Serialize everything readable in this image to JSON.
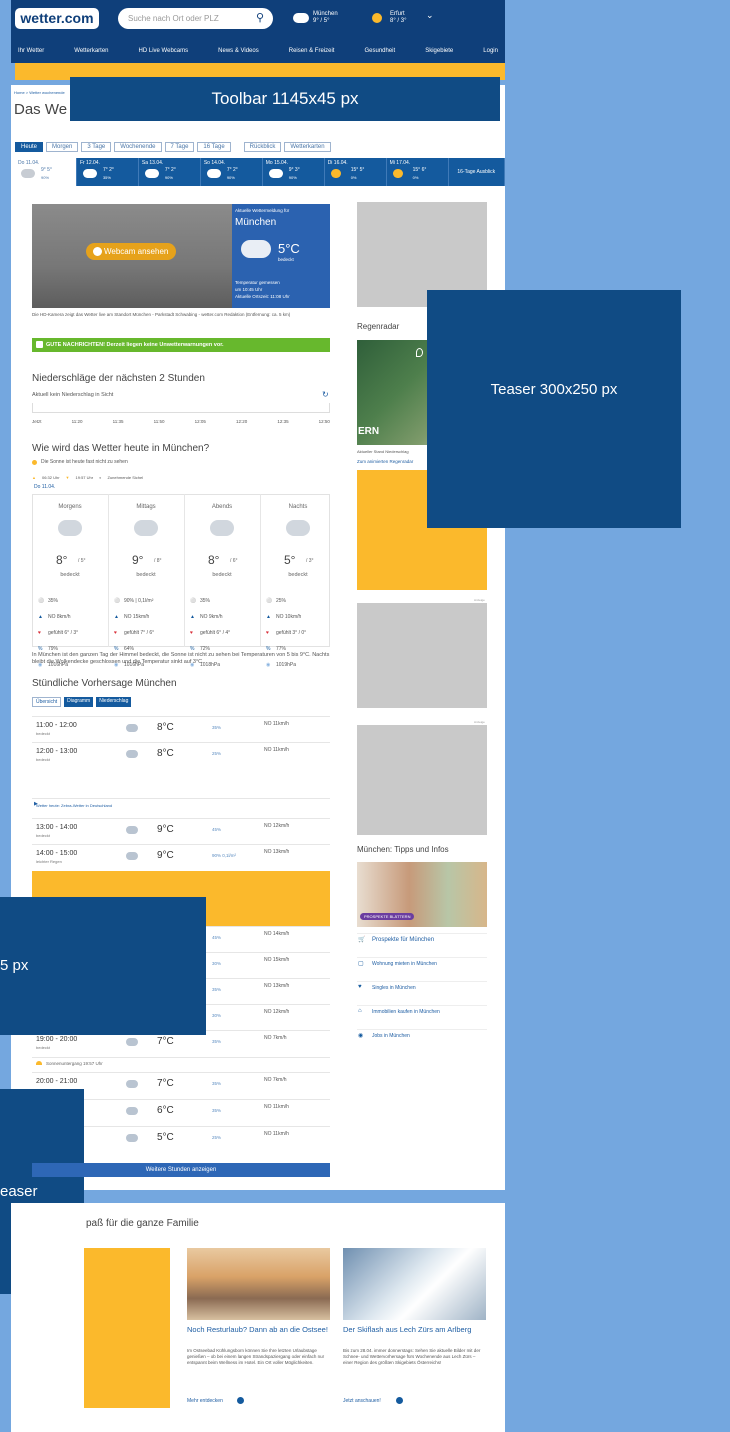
{
  "header": {
    "logo": "wetter.com",
    "search_placeholder": "Suche nach Ort oder PLZ",
    "loc1": "München",
    "loc1_temp": "9° / 5°",
    "loc2": "Erfurt",
    "loc2_temp": "8° / 3°",
    "nav": [
      "Ihr Wetter",
      "Wetterkarten",
      "HD Live Webcams",
      "News & Videos",
      "Reisen & Freizeit",
      "Gesundheit",
      "Skigebiete",
      "Login"
    ]
  },
  "breadcrumb": "Home > Wetter wochenende",
  "page_title": "Das We",
  "toolbar_label": "Toolbar 1145x45 px",
  "tabs": [
    "Heute",
    "Morgen",
    "3 Tage",
    "Wochenende",
    "7 Tage",
    "16 Tage",
    "Rückblick",
    "Wetterkarten"
  ],
  "days": [
    {
      "d": "Do 11.04.",
      "t": "9° 5°",
      "p": "90%"
    },
    {
      "d": "Fr 12.04.",
      "t": "7° 2°",
      "p": "35%"
    },
    {
      "d": "Sa 13.04.",
      "t": "7° 2°",
      "p": "90%"
    },
    {
      "d": "So 14.04.",
      "t": "7° 2°",
      "p": "90%"
    },
    {
      "d": "Mo 15.04.",
      "t": "9° 3°",
      "p": "90%"
    },
    {
      "d": "Di 16.04.",
      "t": "15° 5°",
      "p": "0%"
    },
    {
      "d": "Mi 17.04.",
      "t": "15° 6°",
      "p": "0%"
    }
  ],
  "days_more": "16-Tage Ausblick",
  "webcam": {
    "btn": "Webcam ansehen",
    "box_title": "Aktuelle Wettermeldung für",
    "city": "München",
    "temp": "5°C",
    "cond": "bedeckt",
    "measured": "Temperatur gemessen",
    "time": "um 10:45 Uhr",
    "local": "Aktuelle Ortszeit: 11:08 Uhr",
    "caption": "Die HD-Kamera zeigt das Wetter live am Standort München - Parkstadt Schwabing - wetter.com Redaktion (Entfernung: ca. 5 km)"
  },
  "good_news": "GUTE NACHRICHTEN! Derzeit liegen keine Unwetterwarnungen vor.",
  "precip": {
    "title": "Niederschläge der nächsten 2 Stunden",
    "sub": "Aktuell kein Niederschlag in Sicht",
    "times": [
      "Jetzt",
      "11:20",
      "11:35",
      "11:50",
      "12:05",
      "12:20",
      "12:35",
      "12:50"
    ]
  },
  "today": {
    "title": "Wie wird das Wetter heute in München?",
    "sun": "Die Sonne ist heute fast nicht zu sehen",
    "sunrise": "06:32 Uhr",
    "sunset": "19:57 Uhr",
    "moon": "Zunehmende Sichel",
    "date": "Do 11.04.",
    "cols": [
      {
        "n": "Morgens",
        "t": "8°",
        "l": "/ 5°",
        "c": "bedeckt",
        "r": "35%",
        "w": "NO 8km/h",
        "f": "gefühlt 6° / 3°",
        "h": "79%",
        "p": "1016hPa"
      },
      {
        "n": "Mittags",
        "t": "9°",
        "l": "/ 8°",
        "c": "bedeckt",
        "r": "90% | 0,1l/m²",
        "w": "NO 15km/h",
        "f": "gefühlt 7° / 6°",
        "h": "64%",
        "p": "1016hPa"
      },
      {
        "n": "Abends",
        "t": "8°",
        "l": "/ 6°",
        "c": "bedeckt",
        "r": "35%",
        "w": "NO 9km/h",
        "f": "gefühlt 6° / 4°",
        "h": "72%",
        "p": "1018hPa"
      },
      {
        "n": "Nachts",
        "t": "5°",
        "l": "/ 3°",
        "c": "bedeckt",
        "r": "25%",
        "w": "NO 10km/h",
        "f": "gefühlt 3° / 0°",
        "h": "77%",
        "p": "1019hPa"
      }
    ],
    "summary": "In München ist den ganzen Tag der Himmel bedeckt, die Sonne ist nicht zu sehen bei Temperaturen von 5 bis 9°C. Nachts bleibt die Wolkendecke geschlossen und die Temperatur sinkt auf 3°C."
  },
  "hourly": {
    "title": "Stündliche Vorhersage München",
    "tabs": [
      "Übersicht",
      "Diagramm",
      "Niederschlag"
    ],
    "rows": [
      {
        "tm": "11:00 - 12:00",
        "s": "bedeckt",
        "t": "8°C",
        "p": "35%",
        "w": "NO 11km/h"
      },
      {
        "tm": "12:00 - 13:00",
        "s": "bedeckt",
        "t": "8°C",
        "p": "25%",
        "w": "NO 11km/h"
      },
      {
        "tm": "13:00 - 14:00",
        "s": "bedeckt",
        "t": "9°C",
        "p": "45%",
        "w": "NO 12km/h"
      },
      {
        "tm": "14:00 - 15:00",
        "s": "leichter Regen",
        "t": "9°C",
        "p": "90% 0,1l/m²",
        "w": "NO 13km/h"
      }
    ],
    "rows2": [
      {
        "p": "45%",
        "w": "NO 14km/h"
      },
      {
        "p": "30%",
        "w": "NO 15km/h"
      },
      {
        "p": "35%",
        "w": "NO 13km/h"
      },
      {
        "p": "30%",
        "w": "NO 12km/h"
      }
    ],
    "r19": {
      "tm": "19:00 - 20:00",
      "s": "bedeckt",
      "t": "7°C",
      "p": "35%",
      "w": "NO 7km/h"
    },
    "sunset": "Sonnenuntergang 19:57 Uhr",
    "rows3": [
      {
        "tm": "20:00 - 21:00",
        "t": "7°C",
        "p": "35%",
        "w": "NO 7km/h"
      },
      {
        "tm": "",
        "t": "6°C",
        "p": "35%",
        "w": "NO 11km/h"
      },
      {
        "tm": "",
        "t": "5°C",
        "p": "25%",
        "w": "NO 11km/h"
      }
    ],
    "wetter_link": "Wetter heute: Zebra-Wetter in Deutschland",
    "more": "Weitere Stunden anzeigen"
  },
  "sidebar": {
    "radar": "Regenradar",
    "radar_sub": "Aktueller Stand Niederschlag",
    "radar_link": "Zum animierten Regenradar",
    "radar_map_text": "ERN",
    "anzeige": "Anzeige",
    "tips_title": "München: Tipps und Infos",
    "tips_btn": "PROSPEKTE BLÄTTERN",
    "links": [
      "Prospekte für München",
      "Wohnung mieten in München",
      "Singles in München",
      "Immobilien kaufen in München",
      "Jobs in München"
    ]
  },
  "teaser_label": "Teaser 300x250 px",
  "left_label1": "5 px",
  "left_label2": "easer",
  "family": {
    "title": "paß für die ganze Familie",
    "c1": {
      "t": "Noch Resturlaub? Dann ab an die Ostsee!",
      "b": "Im Ostseebad Kühlungsborn können Sie Ihre letzten Urlaubstage genießen – ob bei einem langen Strandspaziergang oder einfach nur entspannt beim Wellness im Hotel. Ein Ort voller Möglichkeiten.",
      "l": "Mehr entdecken"
    },
    "c2": {
      "t": "Der Skiflash aus Lech Zürs am Arlberg",
      "b": "Bis zum 28.04. immer donnerstags: Sehen Sie aktuelle Bilder mit der Schnee- und Wettervorhersage fürs Wochenende aus Lech Zürs – einer Region des größten Skigebiets Österreichs!",
      "l": "Jetzt anschauen!"
    }
  }
}
